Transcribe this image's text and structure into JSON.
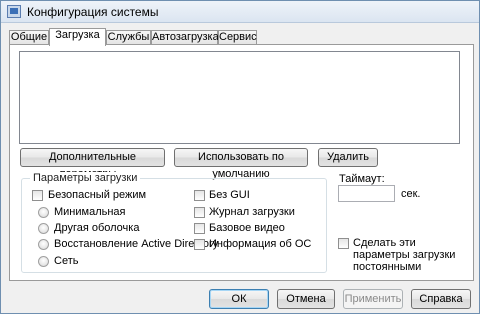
{
  "window": {
    "title": "Конфигурация системы"
  },
  "tabs": [
    {
      "label": "Общие"
    },
    {
      "label": "Загрузка"
    },
    {
      "label": "Службы"
    },
    {
      "label": "Автозагрузка"
    },
    {
      "label": "Сервис"
    }
  ],
  "active_tab": "Загрузка",
  "boot_buttons": {
    "advanced": "Дополнительные параметры...",
    "set_default": "Использовать по умолчанию",
    "delete": "Удалить"
  },
  "boot_options": {
    "title": "Параметры загрузки",
    "safe_boot": "Безопасный режим",
    "minimal": "Минимальная",
    "alternate_shell": "Другая оболочка",
    "ad_repair": "Восстановление Active Directory",
    "network": "Сеть",
    "no_gui": "Без GUI",
    "boot_log": "Журнал загрузки",
    "base_video": "Базовое видео",
    "os_info": "Информация  об ОС"
  },
  "timeout": {
    "label": "Таймаут:",
    "value": "",
    "unit": "сек."
  },
  "make_permanent": "Сделать эти параметры загрузки постоянными",
  "footer": {
    "ok": "ОК",
    "cancel": "Отмена",
    "apply": "Применить",
    "help": "Справка"
  }
}
